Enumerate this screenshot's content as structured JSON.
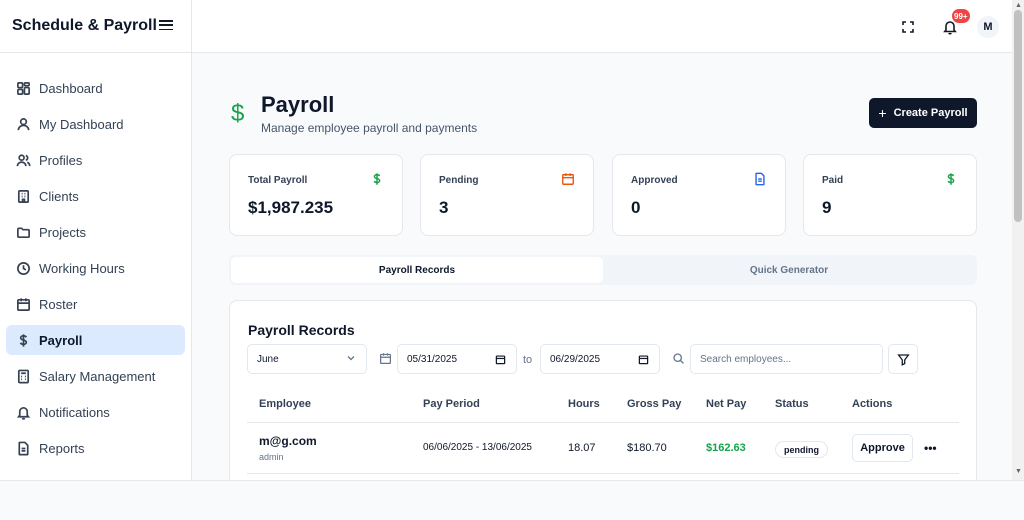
{
  "app": {
    "title": "Schedule & Payroll"
  },
  "sidebar": {
    "items": [
      {
        "label": "Dashboard",
        "icon": "dashboard-grid-icon"
      },
      {
        "label": "My Dashboard",
        "icon": "user-icon"
      },
      {
        "label": "Profiles",
        "icon": "users-icon"
      },
      {
        "label": "Clients",
        "icon": "building-icon"
      },
      {
        "label": "Projects",
        "icon": "folder-icon"
      },
      {
        "label": "Working Hours",
        "icon": "clock-icon"
      },
      {
        "label": "Roster",
        "icon": "calendar-icon"
      },
      {
        "label": "Payroll",
        "icon": "dollar-icon",
        "active": true
      },
      {
        "label": "Salary Management",
        "icon": "calculator-icon"
      },
      {
        "label": "Notifications",
        "icon": "bell-icon"
      },
      {
        "label": "Reports",
        "icon": "file-icon"
      }
    ]
  },
  "topbar": {
    "notification_count": "99+",
    "avatar_initial": "M"
  },
  "page": {
    "title": "Payroll",
    "subtitle": "Manage employee payroll and payments",
    "create_button": "Create Payroll"
  },
  "stats": [
    {
      "label": "Total Payroll",
      "value": "$1,987.235",
      "icon": "dollar-icon",
      "color": "#16a34a"
    },
    {
      "label": "Pending",
      "value": "3",
      "icon": "calendar-icon",
      "color": "#ea580c"
    },
    {
      "label": "Approved",
      "value": "0",
      "icon": "document-icon",
      "color": "#2563eb"
    },
    {
      "label": "Paid",
      "value": "9",
      "icon": "dollar-icon",
      "color": "#16a34a"
    }
  ],
  "tabs": [
    "Payroll Records",
    "Quick Generator"
  ],
  "records": {
    "title": "Payroll Records",
    "filters": {
      "month": "June",
      "date_from": "05/31/2025",
      "to_label": "to",
      "date_to": "06/29/2025",
      "search_placeholder": "Search employees..."
    },
    "columns": [
      "Employee",
      "Pay Period",
      "Hours",
      "Gross Pay",
      "Net Pay",
      "Status",
      "Actions"
    ],
    "rows": [
      {
        "employee": "m@g.com",
        "role": "admin",
        "period": "06/06/2025 - 13/06/2025",
        "hours": "18.07",
        "gross": "$180.70",
        "net": "$162.63",
        "status": "pending",
        "action": "Approve",
        "more": "•••"
      }
    ]
  },
  "colors": {
    "accent": "#0f172a",
    "active_nav": "#dbeafe",
    "net_pay": "#16a34a"
  }
}
